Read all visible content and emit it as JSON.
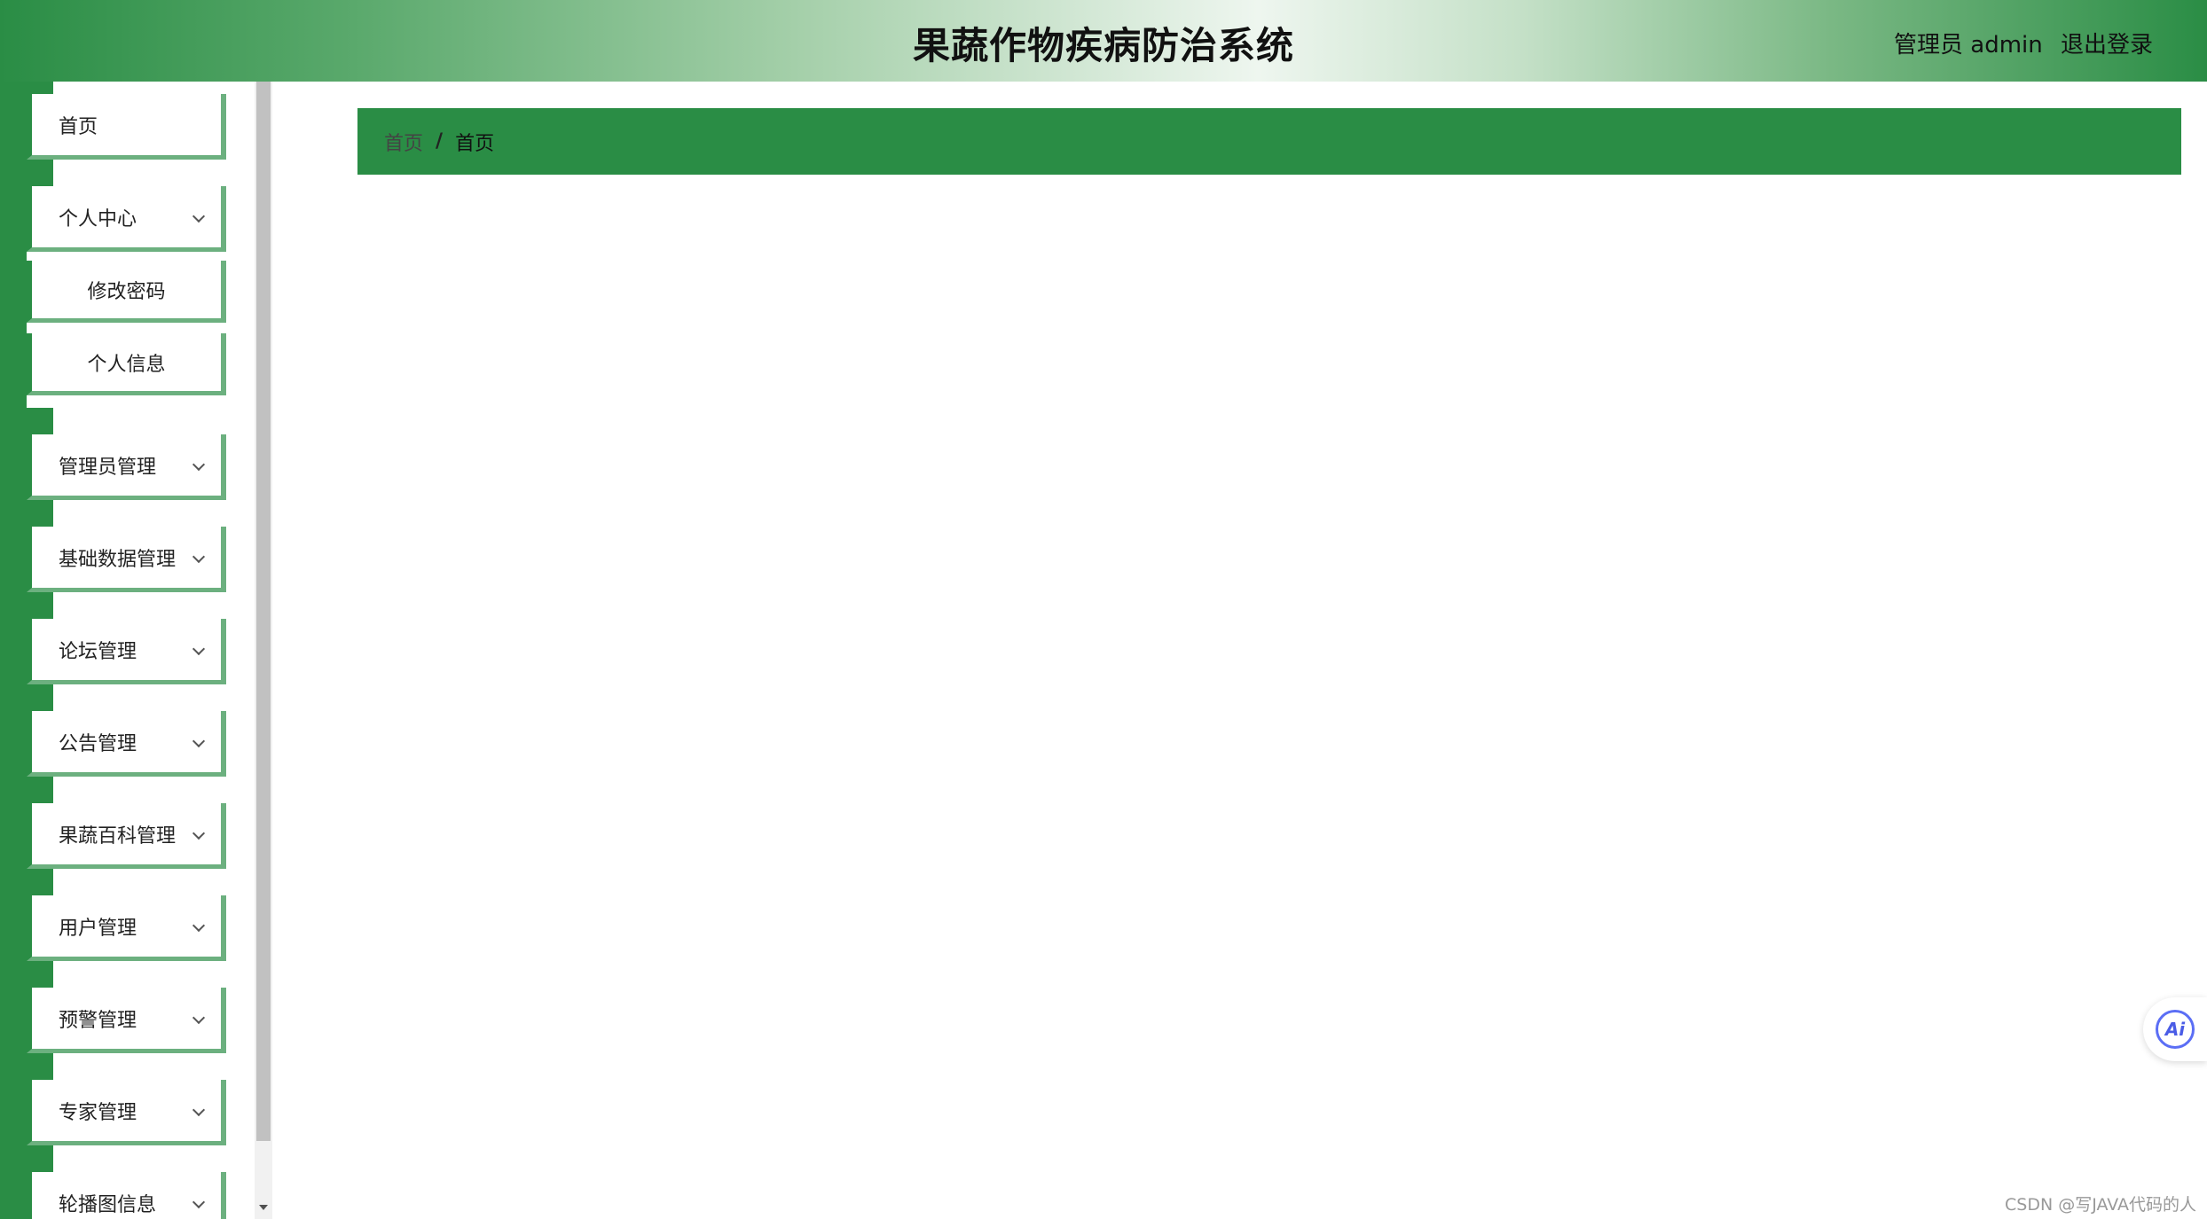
{
  "header": {
    "title": "果蔬作物疾病防治系统",
    "user": "管理员 admin",
    "logout": "退出登录"
  },
  "sidebar": {
    "items": [
      {
        "label": "首页",
        "has_children": false
      },
      {
        "label": "个人中心",
        "has_children": true,
        "expanded": true,
        "children": [
          "修改密码",
          "个人信息"
        ]
      },
      {
        "label": "管理员管理",
        "has_children": true
      },
      {
        "label": "基础数据管理",
        "has_children": true
      },
      {
        "label": "论坛管理",
        "has_children": true
      },
      {
        "label": "公告管理",
        "has_children": true
      },
      {
        "label": "果蔬百科管理",
        "has_children": true
      },
      {
        "label": "用户管理",
        "has_children": true
      },
      {
        "label": "预警管理",
        "has_children": true
      },
      {
        "label": "专家管理",
        "has_children": true
      },
      {
        "label": "轮播图信息",
        "has_children": true
      }
    ]
  },
  "breadcrumb": {
    "items": [
      "首页",
      "首页"
    ],
    "separator": "/"
  },
  "ai_button": {
    "label": "Ai"
  },
  "watermark": "CSDN @写JAVA代码的人",
  "colors": {
    "primary_green": "#2a8d45",
    "border_green": "#6cb07f",
    "ai_blue": "#5b6ef5"
  }
}
